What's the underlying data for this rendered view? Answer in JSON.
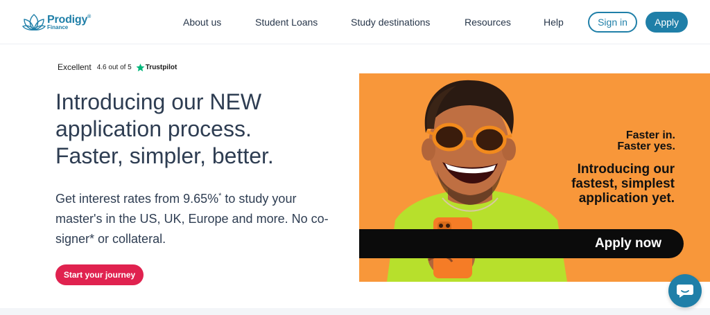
{
  "header": {
    "logo_name": "Prodigy",
    "logo_sub": "Finance",
    "nav": [
      "About us",
      "Student Loans",
      "Study destinations",
      "Resources",
      "Help"
    ],
    "signin_label": "Sign in",
    "apply_label": "Apply"
  },
  "trust": {
    "label": "Excellent",
    "score": "4.6 out of 5",
    "brand": "Trustpilot"
  },
  "hero": {
    "headline_line1": "Introducing our NEW",
    "headline_line2": "application process.",
    "headline_line3": "Faster, simpler, better.",
    "sub_prefix": "Get interest rates from ",
    "sub_rate": "9.65%",
    "sub_mark": "*",
    "sub_suffix": " to study your master's in the US, UK, Europe and more. No co-signer* or collateral.",
    "cta_label": "Start your journey"
  },
  "banner": {
    "tag_line1": "Faster in.",
    "tag_line2": "Faster yes.",
    "msg_line1": "Introducing our",
    "msg_line2": "fastest, simplest",
    "msg_line3": "application yet.",
    "apply_label": "Apply now"
  },
  "colors": {
    "brand": "#1f7fa8",
    "cta": "#e0224f",
    "banner_bg": "#f8973a",
    "shirt": "#b7e02c"
  },
  "icons": {
    "logo": "lotus-logo-icon",
    "star": "trustpilot-star-icon",
    "chat": "chat-bubble-icon"
  }
}
